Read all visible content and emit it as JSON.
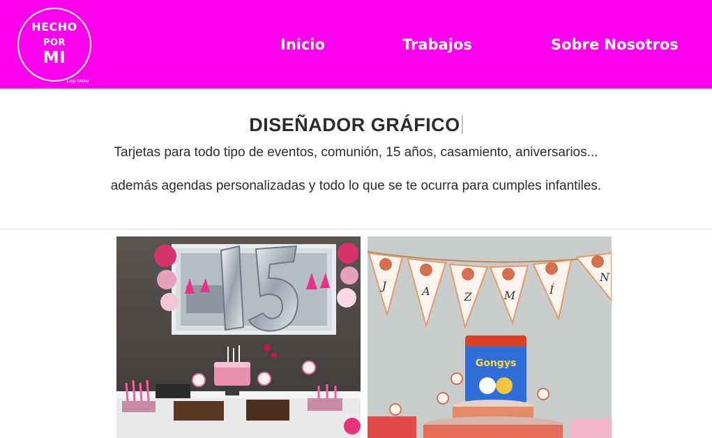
{
  "brand": {
    "logo_line1": "HECHO",
    "logo_line2": "POR",
    "logo_line3": "MI",
    "logo_small": "Logo Maker"
  },
  "nav": {
    "items": [
      {
        "label": "Inicio"
      },
      {
        "label": "Trabajos"
      },
      {
        "label": "Sobre Nosotros"
      }
    ]
  },
  "hero": {
    "title": "DISEÑADOR GRÁFICO",
    "line1": "Tarjetas para todo tipo de eventos, comunión, 15 años, casamiento, aniversarios...",
    "line2": "además agendas personalizadas y todo lo que se te ocurra para cumples infantiles."
  },
  "gallery": {
    "photo1": {
      "balloon_text": "15"
    },
    "photo2": {
      "banner_letters": [
        "J",
        "A",
        "Z",
        "M",
        "Í",
        "N"
      ],
      "snack_brand": "Gongys"
    }
  },
  "colors": {
    "navbar_bg": "#ff00ee",
    "nav_text": "#ffffff",
    "body_text": "#2b2b2b"
  }
}
